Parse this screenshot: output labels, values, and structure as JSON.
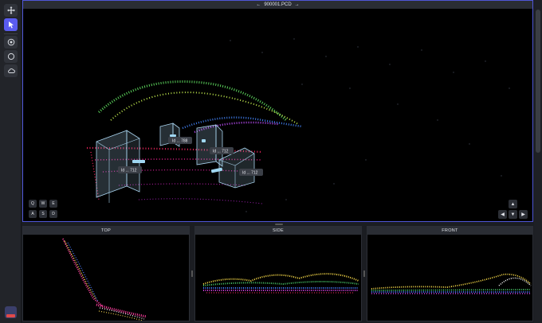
{
  "viewport": {
    "title": "900001.PCD"
  },
  "labels": [
    {
      "id": "cube-1",
      "text": "Id ... 788"
    },
    {
      "id": "cube-2",
      "text": "Id ... 712"
    },
    {
      "id": "cube-3",
      "text": "Id ... 712"
    },
    {
      "id": "cube-4",
      "text": "Id ... 712"
    }
  ],
  "keys": [
    "Q",
    "W",
    "E",
    "A",
    "S",
    "D"
  ],
  "nav": {
    "up": "▲",
    "left": "◀",
    "down": "▼",
    "right": "▶"
  },
  "panels": {
    "top": "TOP",
    "side": "SIDE",
    "front": "FRONT"
  },
  "colors": {
    "accent": "#5a5cf0",
    "viewport_border": "#4f56d8"
  },
  "icons": [
    "move-icon",
    "pointer-icon",
    "target-icon",
    "circle-icon",
    "cloud-icon",
    "app-logo-icon"
  ]
}
